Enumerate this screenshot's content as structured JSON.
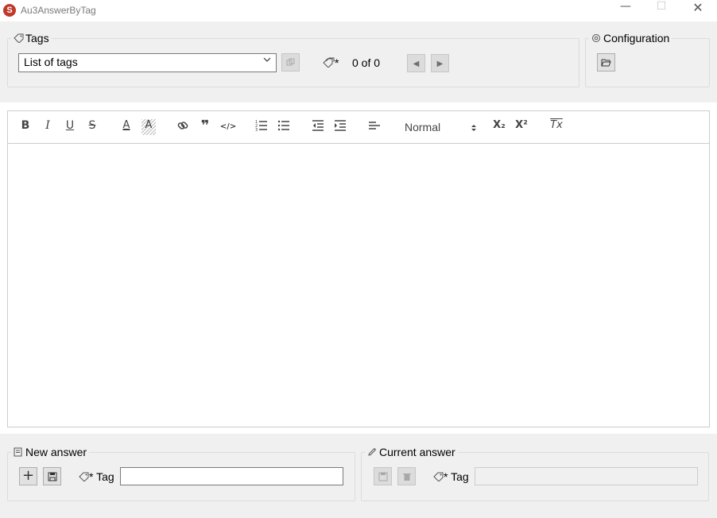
{
  "window": {
    "app_icon": "S",
    "title": "Au3AnswerByTag",
    "minimize_glyph": "—",
    "maximize_glyph": "☐",
    "close_glyph": "✕"
  },
  "tags": {
    "legend": "Tags",
    "legend_icon": "tag-icon",
    "select_value": "List of tags",
    "copy_button_icon": "copy-icon",
    "tags_icon_label": "*",
    "counter": "0 of 0",
    "prev_icon": "◀",
    "next_icon": "▶"
  },
  "configuration": {
    "legend": "Configuration",
    "legend_icon": "gear-icon",
    "open_folder_icon": "folder-open-icon"
  },
  "toolbar": {
    "bold": "B",
    "italic": "I",
    "underline": "U",
    "strike": "S",
    "font_color": "A",
    "background_color": "A",
    "link": "link-icon",
    "blockquote": "❞",
    "code": "</>",
    "ordered_list": "ordered-list-icon",
    "bullet_list": "bullet-list-icon",
    "outdent": "outdent-icon",
    "indent": "indent-icon",
    "align": "align-left-icon",
    "format_value": "Normal",
    "subscript": "X₂",
    "superscript": "X²",
    "clean": "Tx"
  },
  "new_answer": {
    "legend": "New answer",
    "legend_icon": "note-icon",
    "add_label": "+",
    "save_icon": "save-icon",
    "tag_label": "* Tag",
    "tag_value": ""
  },
  "current_answer": {
    "legend": "Current answer",
    "legend_icon": "pencil-icon",
    "save_icon": "save-icon",
    "delete_icon": "trash-icon",
    "tag_label": "* Tag",
    "tag_value": ""
  },
  "colors": {
    "window_bg": "#f0f0f0",
    "editor_bg": "#ffffff",
    "border": "#cccccc"
  }
}
